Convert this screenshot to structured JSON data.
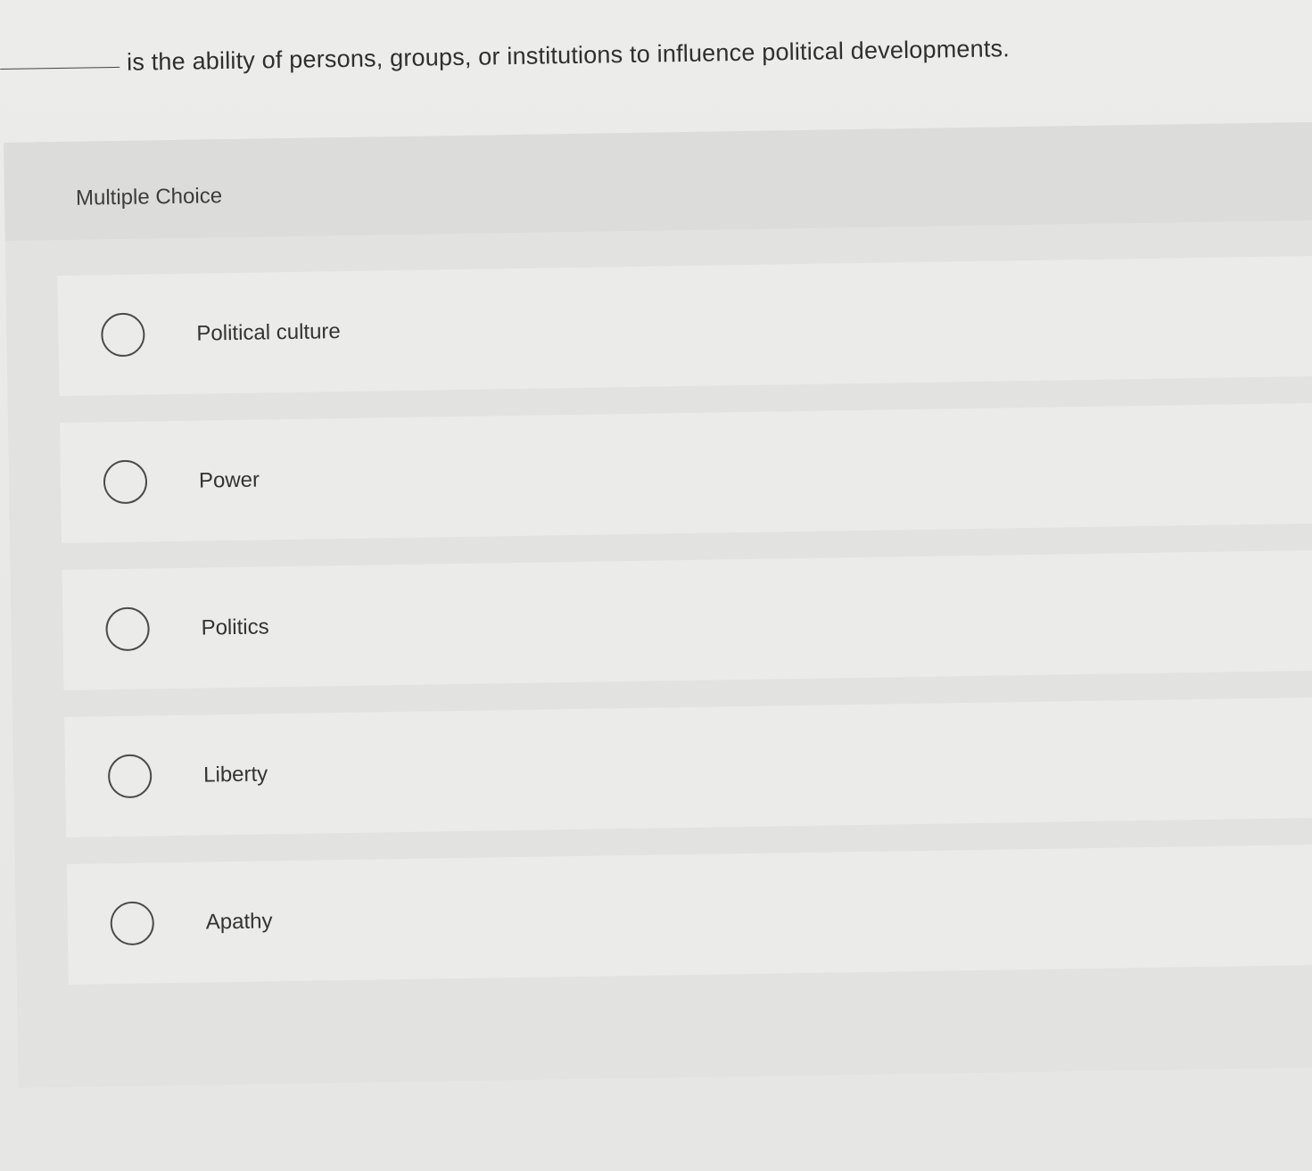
{
  "question": {
    "text": "is the ability of persons, groups, or institutions to influence political developments."
  },
  "section": {
    "label": "Multiple Choice"
  },
  "options": [
    {
      "label": "Political culture"
    },
    {
      "label": "Power"
    },
    {
      "label": "Politics"
    },
    {
      "label": "Liberty"
    },
    {
      "label": "Apathy"
    }
  ]
}
